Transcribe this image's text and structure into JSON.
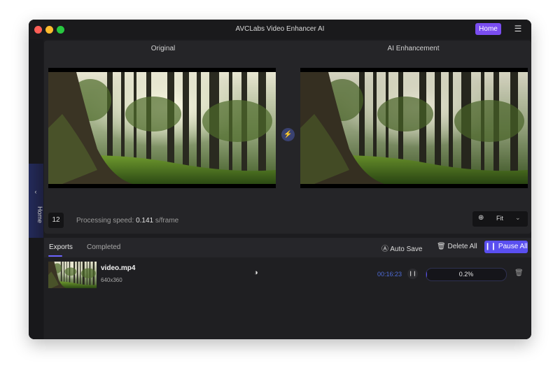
{
  "window": {
    "title": "AVCLabs Video Enhancer AI",
    "home_button": "Home"
  },
  "sidebar": {
    "home_label": "Home"
  },
  "preview": {
    "original_label": "Original",
    "enhanced_label": "AI Enhancement",
    "frame_number": "12",
    "speed_label": "Processing speed: ",
    "speed_value": "0.141",
    "speed_unit": " s/frame",
    "zoom_label": "Fit"
  },
  "tabs": {
    "exports": "Exports",
    "completed": "Completed"
  },
  "toolbar": {
    "auto_save": "Auto Save",
    "delete_all": "Delete All",
    "pause_all": "Pause All"
  },
  "exports": [
    {
      "file_name": "video.mp4",
      "resolution": "640x360",
      "time": "00:16:23",
      "progress_text": "0.2%",
      "progress": 0.002
    }
  ],
  "colors": {
    "accent": "#5a4ff0",
    "home_button": "#7a4df0",
    "time_text": "#4e6bd8"
  },
  "icons": [
    "menu-icon",
    "chevron-left-icon",
    "swap-icon",
    "zoom-icon",
    "chevron-down-icon",
    "auto-save-icon",
    "trash-icon",
    "pause-icon",
    "contrast-icon"
  ]
}
